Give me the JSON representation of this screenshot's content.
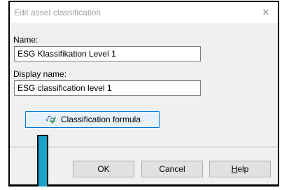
{
  "dialog": {
    "title": "Edit asset classification",
    "close_glyph": "×",
    "name_label": "Name:",
    "name_value": "ESG Klassifikation Level 1",
    "display_name_label": "Display name:",
    "display_name_value": "ESG classification level 1",
    "formula_button_label": "Classification formula",
    "formula_icon": "formula-check-icon",
    "ok_label": "OK",
    "cancel_label": "Cancel",
    "help_label_underlined": "H",
    "help_label_rest": "elp",
    "accent_color": "#0078d7",
    "marker_color": "#1aa3c9"
  }
}
